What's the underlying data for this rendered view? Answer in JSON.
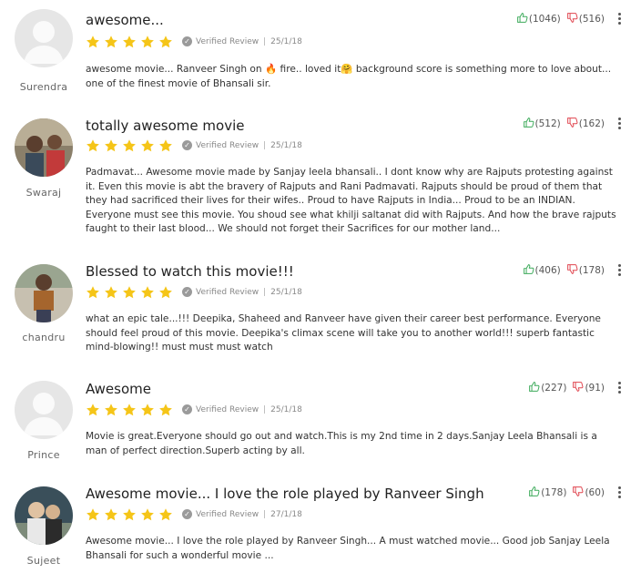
{
  "reviews": [
    {
      "user": "Surendra",
      "title": "awesome...",
      "rating": 5,
      "verified": "Verified Review",
      "date": "25/1/18",
      "up": "(1046)",
      "down": "(516)",
      "body": "awesome movie... Ranveer Singh on 🔥 fire.. loved it🤗 background score is something more to love about... one of the finest movie of Bhansali sir.",
      "avatar": "placeholder"
    },
    {
      "user": "Swaraj",
      "title": "totally awesome movie",
      "rating": 5,
      "verified": "Verified Review",
      "date": "25/1/18",
      "up": "(512)",
      "down": "(162)",
      "body": "Padmavat... Awesome movie made by Sanjay leela bhansali.. I dont know why are Rajputs protesting against it. Even this movie is abt the bravery of Rajputs and Rani Padmavati. Rajputs should be proud of them that they had sacrificed their lives for their wifes.. Proud to have Rajputs in India... Proud to be an INDIAN. Everyone must see this movie. You shoud see what khilji saltanat did with Rajputs. And how the brave rajputs faught to their last blood... We should not forget their Sacrifices for our mother land...",
      "avatar": "photo"
    },
    {
      "user": "chandru",
      "title": "Blessed to watch this movie!!!",
      "rating": 5,
      "verified": "Verified Review",
      "date": "25/1/18",
      "up": "(406)",
      "down": "(178)",
      "body": "what an epic tale...!!! Deepika, Shaheed and Ranveer have given their career best performance. Everyone should feel proud of this movie. Deepika's climax scene will take you to another world!!! superb fantastic mind-blowing!! must must must watch",
      "avatar": "photo"
    },
    {
      "user": "Prince",
      "title": "Awesome",
      "rating": 5,
      "verified": "Verified Review",
      "date": "25/1/18",
      "up": "(227)",
      "down": "(91)",
      "body": "Movie is great.Everyone should go out and watch.This is my 2nd time in 2 days.Sanjay Leela Bhansali is a man of perfect direction.Superb acting by all.",
      "avatar": "placeholder"
    },
    {
      "user": "Sujeet",
      "title": "Awesome movie... I love the role played by Ranveer Singh",
      "rating": 5,
      "verified": "Verified Review",
      "date": "27/1/18",
      "up": "(178)",
      "down": "(60)",
      "body": "Awesome movie... I love the role played by Ranveer Singh... A must watched movie... Good job Sanjay Leela Bhansali for such a wonderful movie ...",
      "avatar": "photo"
    }
  ],
  "colors": {
    "star": "#f5c518",
    "up": "#3caa5a",
    "down": "#e0454f"
  }
}
